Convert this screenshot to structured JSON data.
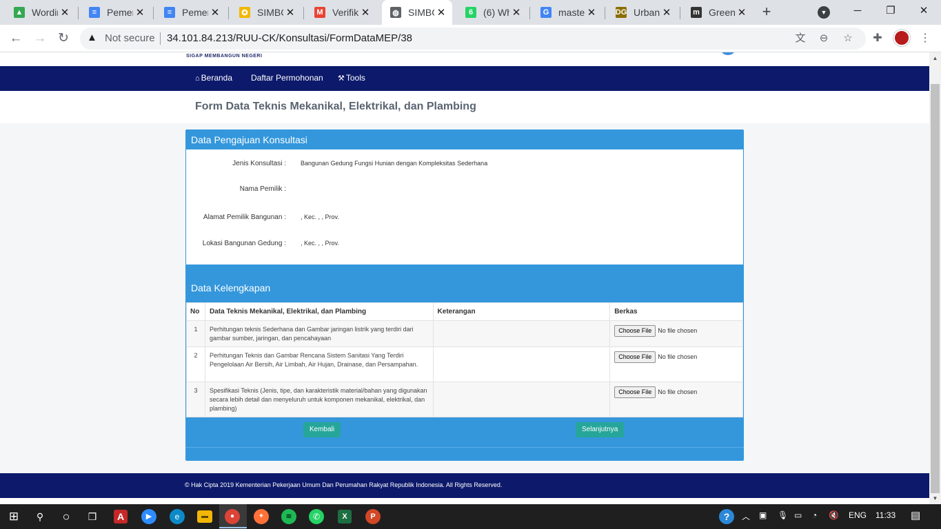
{
  "browser": {
    "tabs": [
      {
        "label": "Wordin",
        "favicon": "drive-icon",
        "color": "#34a853",
        "glyph": "▲"
      },
      {
        "label": "Pemeri",
        "favicon": "docs-icon",
        "color": "#4285f4",
        "glyph": "≡"
      },
      {
        "label": "Pemeri",
        "favicon": "docs-icon",
        "color": "#4285f4",
        "glyph": "≡"
      },
      {
        "label": "SIMBG",
        "favicon": "simbg-icon",
        "color": "#f2b705",
        "glyph": "✪"
      },
      {
        "label": "Verifik",
        "favicon": "gmail-icon",
        "color": "#ea4335",
        "glyph": "M"
      },
      {
        "label": "SIMBG",
        "favicon": "globe-icon",
        "color": "#5f6368",
        "glyph": "◍"
      },
      {
        "label": "(6) Wh",
        "favicon": "whatsapp-icon",
        "color": "#25d366",
        "glyph": "6"
      },
      {
        "label": "master",
        "favicon": "google-icon",
        "color": "#4285f4",
        "glyph": "G"
      },
      {
        "label": "Urban",
        "favicon": "urban-icon",
        "color": "#8a6d00",
        "glyph": "DG"
      },
      {
        "label": "Green",
        "favicon": "mendeley-icon",
        "color": "#333333",
        "glyph": "m"
      }
    ],
    "active_tab_index": 5,
    "close_glyph": "✕",
    "new_tab": "+",
    "window": {
      "minimize": "─",
      "maximize": "❐",
      "close": "✕"
    },
    "nav": {
      "back": "←",
      "forward": "→",
      "reload": "↻"
    },
    "omnibox": {
      "warning": "▲",
      "security_label": "Not secure",
      "url": "34.101.84.213/RUU-CK/Konsultasi/FormDataMEP/38"
    }
  },
  "site": {
    "logo_tagline": "SIGAP MEMBANGUN NEGERI",
    "nav": [
      {
        "label": "Beranda",
        "icon": "⌂",
        "icon_name": "home-icon"
      },
      {
        "label": "Daftar Permohonan",
        "icon": "",
        "icon_name": ""
      },
      {
        "label": "Tools",
        "icon": "⚒",
        "icon_name": "tools-icon"
      }
    ],
    "page_title": "Form Data Teknis Mekanikal, Elektrikal, dan Plambing"
  },
  "konsultasi": {
    "heading": "Data Pengajuan Konsultasi",
    "fields": [
      {
        "label": "Jenis Konsultasi :",
        "value": "Bangunan Gedung Fungsi Hunian dengan Kompleksitas Sederhana"
      },
      {
        "label": "Nama Pemilik :",
        "value": ""
      },
      {
        "label": "Alamat Pemilik Bangunan :",
        "value": ", Kec. , , Prov."
      },
      {
        "label": "Lokasi Bangunan Gedung :",
        "value": ", Kec. , , Prov."
      }
    ]
  },
  "kelengkapan": {
    "heading": "Data Kelengkapan",
    "columns": [
      "No",
      "Data Teknis Mekanikal, Elektrikal, dan Plambing",
      "Keterangan",
      "Berkas"
    ],
    "rows": [
      {
        "no": "1",
        "data": "Perhitungan teknis Sederhana dan Gambar jaringan listrik yang terdiri dari gambar sumber, jaringan, dan pencahayaan",
        "keterangan": "",
        "file_button": "Choose File",
        "file_status": "No file chosen"
      },
      {
        "no": "2",
        "data": "Perhitungan Teknis dan Gambar Rencana Sistem Sanitasi Yang Terdiri Pengelolaan Air Bersih, Air Limbah, Air Hujan, Drainase, dan Persampahan.",
        "keterangan": "",
        "file_button": "Choose File",
        "file_status": "No file chosen"
      },
      {
        "no": "3",
        "data": "Spesifikasi Teknis (Jenis, tipe, dan karakteristik material/bahan yang digunakan secara lebih detail dan menyeluruh untuk komponen mekanikal, elektrikal, dan plambing)",
        "keterangan": "",
        "file_button": "Choose File",
        "file_status": "No file chosen"
      }
    ],
    "back_button": "Kembali",
    "next_button": "Selanjutnya"
  },
  "footer": {
    "text": "© Hak Cipta 2019 Kementerian Pekerjaan Umum Dan Perumahan Rakyat Republik Indonesia. All Rights Reserved."
  },
  "taskbar": {
    "language": "ENG",
    "time": "11:33"
  },
  "colors": {
    "nav_bg": "#0d1a6b",
    "panel_bg": "#3497dc",
    "button_bg": "#26a69a"
  }
}
